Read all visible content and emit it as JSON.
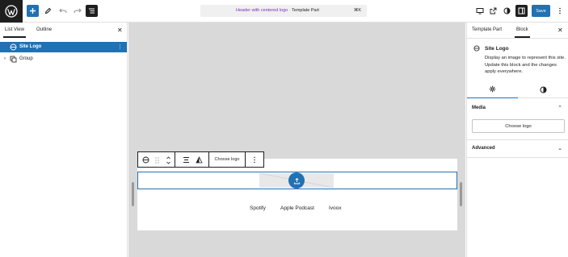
{
  "topbar": {
    "document_title_part": "Header with centered logo",
    "document_title_separator": " · ",
    "document_title_type": "Template Part",
    "shortcut": "⌘K",
    "save_label": "Save"
  },
  "left_panel": {
    "tabs": [
      {
        "label": "List View"
      },
      {
        "label": "Outline"
      }
    ],
    "rows": [
      {
        "label": "Site Logo"
      },
      {
        "label": "Group"
      }
    ]
  },
  "canvas": {
    "block_toolbar": {
      "choose_logo_label": "Choose logo"
    },
    "nav_links": [
      "Spotify",
      "Apple Podcast",
      "Ivoox"
    ]
  },
  "right_panel": {
    "tabs": [
      {
        "label": "Template Part"
      },
      {
        "label": "Block"
      }
    ],
    "block": {
      "name": "Site Logo",
      "description": "Display an image to represent this site. Update this block and the changes apply everywhere."
    },
    "panels": [
      {
        "label": "Media",
        "button_label": "Choose logo"
      },
      {
        "label": "Advanced"
      }
    ]
  },
  "colors": {
    "accent": "#2271b1",
    "dark": "#1e1e1e",
    "canvas_bg": "#d9d9d9",
    "title_purple": "#7a2fbf"
  }
}
